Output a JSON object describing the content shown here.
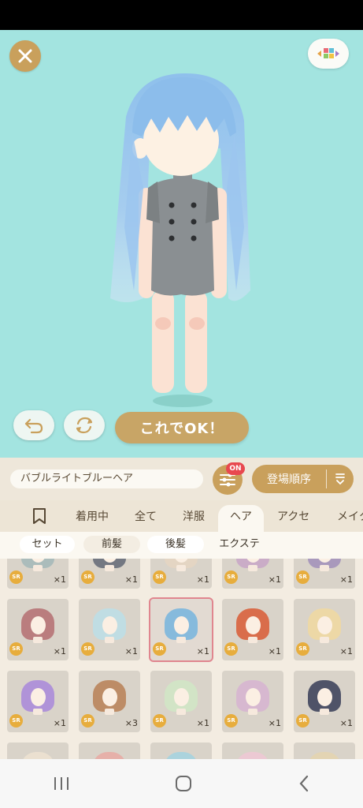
{
  "stage": {
    "ok_label": "これでOK！"
  },
  "item_name": "バブルライトブルーヘア",
  "filter": {
    "badge": "ON"
  },
  "sort": {
    "label": "登場順序"
  },
  "tabs": [
    {
      "label": "bookmark-icon",
      "icon": true
    },
    {
      "label": "着用中"
    },
    {
      "label": "全て"
    },
    {
      "label": "洋服"
    },
    {
      "label": "ヘア",
      "active": true
    },
    {
      "label": "アクセ"
    },
    {
      "label": "メイク"
    }
  ],
  "subtabs": [
    {
      "label": "セット"
    },
    {
      "label": "前髪"
    },
    {
      "label": "後髪"
    },
    {
      "label": "エクステ"
    }
  ],
  "items": [
    {
      "rarity": "SR",
      "count": "×1",
      "hair": "#9fb6b8"
    },
    {
      "rarity": "SR",
      "count": "×1",
      "hair": "#5a6170"
    },
    {
      "rarity": "SR",
      "count": "×1",
      "hair": "#e6d6c2"
    },
    {
      "rarity": "SR",
      "count": "×1",
      "hair": "#c6a2c7"
    },
    {
      "rarity": "SR",
      "count": "×1",
      "hair": "#9c8bb9"
    },
    {
      "rarity": "SR",
      "count": "×1",
      "hair": "#b1686c"
    },
    {
      "rarity": "SR",
      "count": "×1",
      "hair": "#b9e0ea"
    },
    {
      "rarity": "SR",
      "count": "×1",
      "hair": "#6fb2df",
      "selected": true
    },
    {
      "rarity": "SR",
      "count": "×1",
      "hair": "#d8542c"
    },
    {
      "rarity": "SR",
      "count": "×1",
      "hair": "#f1d99e"
    },
    {
      "rarity": "SR",
      "count": "×1",
      "hair": "#a583dc"
    },
    {
      "rarity": "SR",
      "count": "×3",
      "hair": "#b57b4e"
    },
    {
      "rarity": "SR",
      "count": "×1",
      "hair": "#cfe8c6"
    },
    {
      "rarity": "SR",
      "count": "×1",
      "hair": "#d6b2d2"
    },
    {
      "rarity": "SR",
      "count": "×1",
      "hair": "#2c3350"
    },
    {
      "rarity": "",
      "count": "",
      "hair": "#efe3d2"
    },
    {
      "rarity": "",
      "count": "",
      "hair": "#e9a7a1"
    },
    {
      "rarity": "",
      "count": "",
      "hair": "#9fd3e2"
    },
    {
      "rarity": "",
      "count": "",
      "hair": "#f0c7d6"
    },
    {
      "rarity": "",
      "count": "",
      "hair": "#e5d4ae"
    }
  ],
  "colors": {
    "stage_bg": "#a3e4e0",
    "accent_gold": "#c9a05c",
    "badge_red": "#e8484f"
  }
}
